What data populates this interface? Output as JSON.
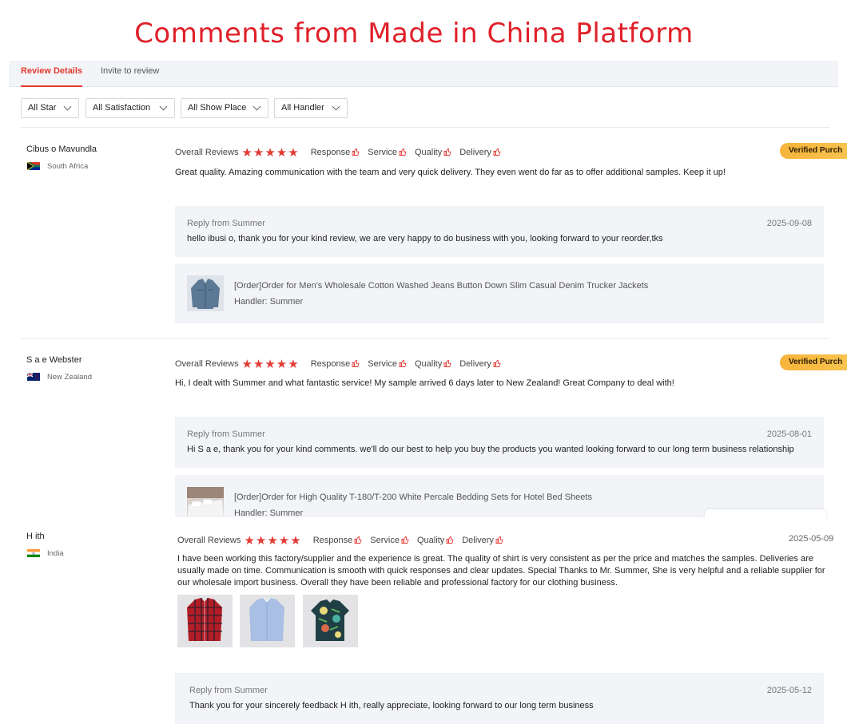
{
  "banner": {
    "title": "Comments from Made in China Platform"
  },
  "tabs": [
    {
      "label": "Review Details",
      "active": true
    },
    {
      "label": "Invite to review",
      "active": false
    }
  ],
  "filters": [
    {
      "label": "All Star"
    },
    {
      "label": "All Satisfaction"
    },
    {
      "label": "All Show Place"
    },
    {
      "label": "All Handler"
    }
  ],
  "labels": {
    "overall": "Overall Reviews",
    "response": "Response",
    "service": "Service",
    "quality": "Quality",
    "delivery": "Delivery",
    "verified": "Verified Purch",
    "stars": "★★★★★"
  },
  "reviews": [
    {
      "name": "Cibus  o Mavundla",
      "country": "South Africa",
      "flag": "south-africa-flag",
      "rating": 5,
      "verified": true,
      "text": "Great quality. Amazing communication with the team and very quick delivery. They even went do far as to offer additional samples. Keep it up!",
      "reply": {
        "from": "Reply from Summer",
        "date": "2025-09-08",
        "text": "hello  ibusi  o, thank you for your kind review, we are very happy to do business with you, looking forward to your reorder,tks"
      },
      "order": {
        "title": "[Order]Order for Men's Wholesale Cotton Washed Jeans Button Down Slim Casual Denim Trucker Jackets",
        "handler": "Handler: Summer"
      }
    },
    {
      "name": "S  a  e Webster",
      "country": "New Zealand",
      "flag": "new-zealand-flag",
      "rating": 5,
      "verified": true,
      "text": "Hi, I dealt with Summer and what fantastic service! My sample arrived 6 days later to New Zealand! Great Company to deal with!",
      "reply": {
        "from": "Reply from Summer",
        "date": "2025-08-01",
        "text": "Hi S  a  e, thank you for your kind comments. we'll do our best to help you buy the products you wanted looking forward to our long term business relationship"
      },
      "order": {
        "title": "[Order]Order for High Quality T-180/T-200 White Percale Bedding Sets for Hotel Bed Sheets",
        "handler": "Handler: Summer"
      }
    },
    {
      "name": "H   ith",
      "country": "India",
      "flag": "india-flag",
      "rating": 5,
      "date": "2025-05-09",
      "text": "I have been working this factory/supplier and the experience is great. The quality of shirt is very consistent as per the price and matches the samples. Deliveries are usually made on time. Communication is smooth with quick responses and clear updates. Special Thanks to Mr. Summer, She is very helpful and a reliable supplier for our wholesale import business. Overall they have been reliable and professional factory for our clothing business.",
      "photos": [
        "red-plaid-shirt-photo",
        "light-blue-shirt-photo",
        "tropical-print-shirt-photo"
      ],
      "reply": {
        "from": "Reply from Summer",
        "date": "2025-05-12",
        "text": "Thank you for your sincerely feedback H   ith, really appreciate, looking forward to our long term business"
      }
    }
  ],
  "colors": {
    "accent": "#e33a2f",
    "title": "#e0202a",
    "star": "#e23b34",
    "badge": "#f7b941",
    "panel": "#f2f4f8"
  }
}
